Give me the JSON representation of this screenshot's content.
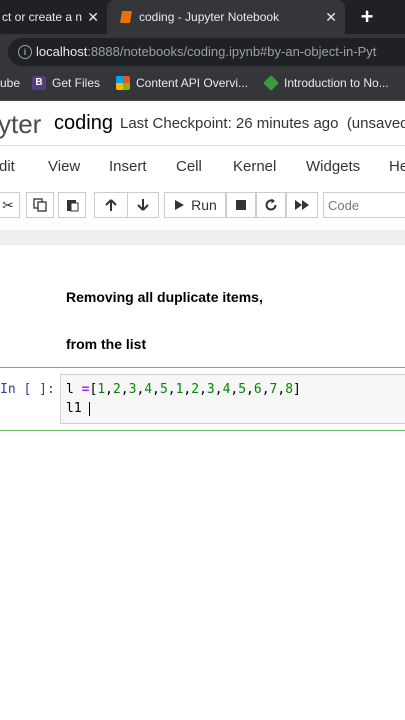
{
  "browser": {
    "tabs": [
      {
        "label": "ct or create a n",
        "close": "✕"
      },
      {
        "label": "coding - Jupyter Notebook",
        "close": "✕"
      }
    ],
    "new_tab": "+",
    "url_host": "localhost",
    "url_path": ":8888/notebooks/coding.ipynb#by-an-object-in-Pyt",
    "bookmarks": [
      "ube",
      "Get Files",
      "Content API Overvi...",
      "Introduction to No..."
    ],
    "bookmark_b_letter": "B"
  },
  "jupyter": {
    "logo_text": "yter",
    "notebook_name": "coding",
    "checkpoint": "Last Checkpoint: 26 minutes ago",
    "unsaved": "(unsaved c",
    "menu": [
      "dit",
      "View",
      "Insert",
      "Cell",
      "Kernel",
      "Widgets",
      "He"
    ],
    "toolbar": {
      "run_label": "Run",
      "celltype": "Code"
    }
  },
  "cells": {
    "markdown_line1": "Removing all duplicate items,",
    "markdown_line2": "from the list",
    "prompt": "In [ ]:",
    "code": {
      "var": "l",
      "op": "=",
      "open": "[",
      "close": "]",
      "values": [
        "1",
        "2",
        "3",
        "4",
        "5",
        "1",
        "2",
        "3",
        "4",
        "5",
        "6",
        "7",
        "8"
      ],
      "line2": "l1 "
    }
  },
  "colors": {
    "chrome_dark": "#202124",
    "chrome_tab": "#35363a",
    "cell_border": "#66bb6a",
    "number": "#008800",
    "operator": "#aa22ff"
  }
}
